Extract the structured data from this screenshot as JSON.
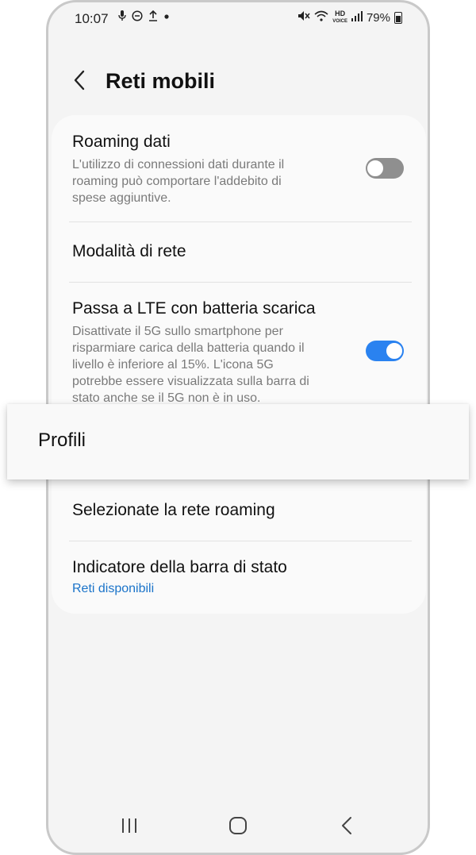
{
  "status_bar": {
    "time": "10:07",
    "left_icons": [
      "mic-icon",
      "do-not-disturb-icon",
      "upload-icon",
      "dot-icon"
    ],
    "hd_label": "HD",
    "battery": "79%",
    "right_icons": [
      "mute-icon",
      "wifi-icon",
      "hd-voice-icon",
      "signal-icon",
      "battery-icon"
    ]
  },
  "header": {
    "title": "Reti mobili"
  },
  "settings": {
    "roaming": {
      "title": "Roaming dati",
      "description": "L'utilizzo di connessioni dati durante il roaming può comportare l'addebito di spese aggiuntive.",
      "enabled": false
    },
    "network_mode": {
      "title": "Modalità di rete"
    },
    "lte_low_battery": {
      "title": "Passa a LTE con batteria scarica",
      "description": "Disattivate il 5G sullo smartphone per risparmiare carica della batteria quando il livello è inferiore al 15%. L'icona 5G potrebbe essere visualizzata sulla barra di stato anche se il 5G non è in uso.",
      "enabled": true
    },
    "roaming_network": {
      "title": "Selezionate la rete roaming"
    },
    "status_indicator": {
      "title": "Indicatore della barra di stato",
      "value": "Reti disponibili"
    }
  },
  "popup": {
    "label": "Profili"
  },
  "navbar": {
    "buttons": [
      "recent-apps-icon",
      "home-icon",
      "back-icon"
    ]
  },
  "colors": {
    "accent": "#2a82f0",
    "link": "#1a73c9",
    "toggle_off": "#8f8f8f"
  }
}
